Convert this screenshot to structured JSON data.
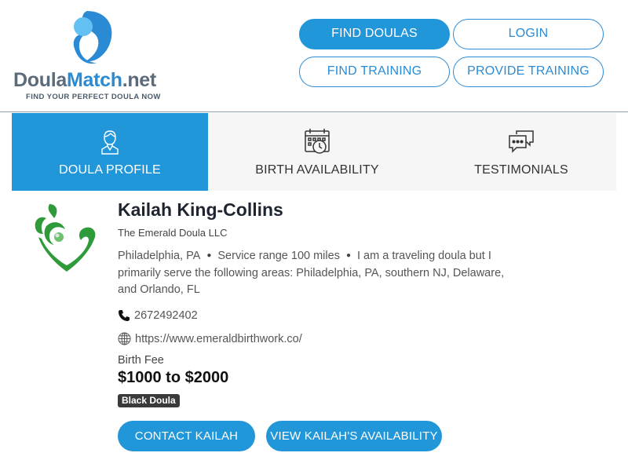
{
  "header": {
    "logo": {
      "name_part1": "Doula",
      "name_part2": "Match",
      "name_part3": ".net",
      "tagline": "FIND YOUR PERFECT DOULA NOW"
    },
    "nav": {
      "find_doulas": "FIND DOULAS",
      "login": "LOGIN",
      "find_training": "FIND TRAINING",
      "provide_training": "PROVIDE TRAINING"
    }
  },
  "tabs": [
    {
      "label": "DOULA PROFILE",
      "icon": "user-icon",
      "active": true
    },
    {
      "label": "BIRTH AVAILABILITY",
      "icon": "calendar-clock-icon",
      "active": false
    },
    {
      "label": "TESTIMONIALS",
      "icon": "chat-bubbles-icon",
      "active": false
    }
  ],
  "profile": {
    "name": "Kailah King-Collins",
    "business": "The Emerald Doula LLC",
    "location": "Philadelphia, PA",
    "service_range": "Service range 100 miles",
    "travel_note": "I am a traveling doula but I primarily serve the following areas: Philadelphia, PA, southern NJ, Delaware, and Orlando, FL",
    "phone": "2672492402",
    "website": "https://www.emeraldbirthwork.co/",
    "fee_label": "Birth Fee",
    "fee_value": "$1000 to $2000",
    "badge": "Black Doula",
    "avatar_icon": "emerald-doula-logo"
  },
  "actions": {
    "contact": "CONTACT KAILAH",
    "availability": "VIEW KAILAH'S AVAILABILITY"
  },
  "colors": {
    "accent": "#2196d8",
    "tab_background": "#f6f6f6",
    "badge_background": "#3a3a3a",
    "logo_green": "#2e9a3a"
  }
}
